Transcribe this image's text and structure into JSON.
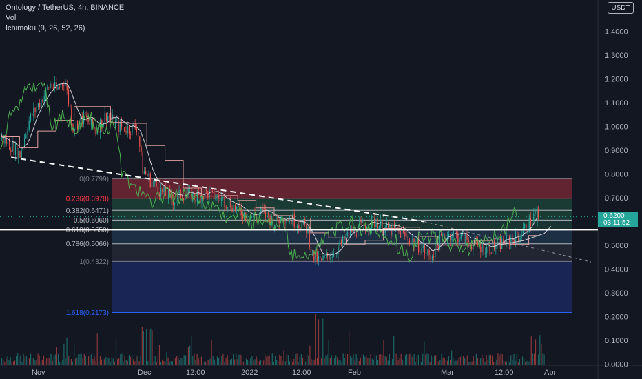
{
  "header": {
    "symbol_line": "Ontology / TetherUS, 4h, BINANCE",
    "vol_label": "Vol",
    "indicator_label": "Ichimoku (9, 26, 52, 26)",
    "currency": "USDT"
  },
  "last_price": {
    "value": "0.6200",
    "countdown": "03:11:52"
  },
  "colors": {
    "background": "#131722",
    "up": "#26a69a",
    "down": "#ef5350",
    "tenkan": "#cfcfd6",
    "kijun": "#e0a0a0",
    "chikou": "#4caf50",
    "fib_red": "#7e2a36",
    "fib_green": "#1e4a3c",
    "fib_blue": "#1d2d6b"
  },
  "chart_data": {
    "type": "candlestick",
    "y_axis": {
      "range": [
        -0.01,
        1.5
      ],
      "ticks": [
        "1.4000",
        "1.3000",
        "1.2000",
        "1.1000",
        "1.0000",
        "0.9000",
        "0.8000",
        "0.7000",
        "0.6000",
        "0.5000",
        "0.4000",
        "0.3000",
        "0.2000",
        "0.1000",
        "0.0000"
      ],
      "tick_values": [
        1.4,
        1.3,
        1.2,
        1.1,
        1.0,
        0.9,
        0.8,
        0.7,
        0.6,
        0.5,
        0.4,
        0.3,
        0.2,
        0.1,
        0.0
      ]
    },
    "x_axis": {
      "labels": [
        "Nov",
        "Dec",
        "12:00",
        "2022",
        "12:00",
        "Feb",
        "Mar",
        "12:00",
        "Apr"
      ]
    },
    "fibonacci": [
      {
        "level": "0",
        "price": 0.7799,
        "label": "0(0.7799)",
        "color": "#787b86"
      },
      {
        "level": "0.236",
        "price": 0.6978,
        "label": "0.236(0.6978)",
        "color": "#f23645"
      },
      {
        "level": "0.382",
        "price": 0.6471,
        "label": "0.382(0.6471)",
        "color": "#b2b5be"
      },
      {
        "level": "0.5",
        "price": 0.606,
        "label": "0.5(0.6060)",
        "color": "#b2b5be"
      },
      {
        "level": "0.618",
        "price": 0.565,
        "label": "0.618(0.5650)",
        "color": "#b2b5be"
      },
      {
        "level": "0.786",
        "price": 0.5066,
        "label": "0.786(0.5066)",
        "color": "#b2b5be"
      },
      {
        "level": "1",
        "price": 0.4322,
        "label": "1(0.4322)",
        "color": "#787b86"
      },
      {
        "level": "1.618",
        "price": 0.2173,
        "label": "1.618(0.2173)",
        "color": "#2962ff"
      }
    ],
    "horizontal_line": 0.565,
    "trendline": [
      [
        0.86,
        0.71
      ],
      [
        1.5,
        0.43
      ]
    ],
    "price_path": [
      [
        0.0,
        0.95
      ],
      [
        0.02,
        0.92
      ],
      [
        0.035,
        0.88
      ],
      [
        0.05,
        1.02
      ],
      [
        0.07,
        1.1
      ],
      [
        0.09,
        1.18
      ],
      [
        0.1,
        1.15
      ],
      [
        0.115,
        1.2
      ],
      [
        0.13,
        1.0
      ],
      [
        0.15,
        1.04
      ],
      [
        0.17,
        0.98
      ],
      [
        0.19,
        1.05
      ],
      [
        0.21,
        1.0
      ],
      [
        0.23,
        0.99
      ],
      [
        0.245,
        1.0
      ],
      [
        0.255,
        0.82
      ],
      [
        0.27,
        0.77
      ],
      [
        0.29,
        0.72
      ],
      [
        0.31,
        0.69
      ],
      [
        0.33,
        0.72
      ],
      [
        0.35,
        0.7
      ],
      [
        0.37,
        0.72
      ],
      [
        0.39,
        0.7
      ],
      [
        0.41,
        0.68
      ],
      [
        0.43,
        0.64
      ],
      [
        0.45,
        0.62
      ],
      [
        0.47,
        0.64
      ],
      [
        0.49,
        0.6
      ],
      [
        0.51,
        0.62
      ],
      [
        0.53,
        0.6
      ],
      [
        0.55,
        0.57
      ],
      [
        0.56,
        0.45
      ],
      [
        0.575,
        0.43
      ],
      [
        0.59,
        0.46
      ],
      [
        0.61,
        0.5
      ],
      [
        0.63,
        0.56
      ],
      [
        0.65,
        0.58
      ],
      [
        0.67,
        0.6
      ],
      [
        0.69,
        0.57
      ],
      [
        0.71,
        0.56
      ],
      [
        0.73,
        0.53
      ],
      [
        0.75,
        0.5
      ],
      [
        0.77,
        0.45
      ],
      [
        0.79,
        0.53
      ],
      [
        0.81,
        0.55
      ],
      [
        0.83,
        0.53
      ],
      [
        0.85,
        0.5
      ],
      [
        0.87,
        0.49
      ],
      [
        0.89,
        0.5
      ],
      [
        0.91,
        0.52
      ],
      [
        0.93,
        0.54
      ],
      [
        0.95,
        0.6
      ],
      [
        0.96,
        0.64
      ],
      [
        0.965,
        0.62
      ]
    ]
  }
}
